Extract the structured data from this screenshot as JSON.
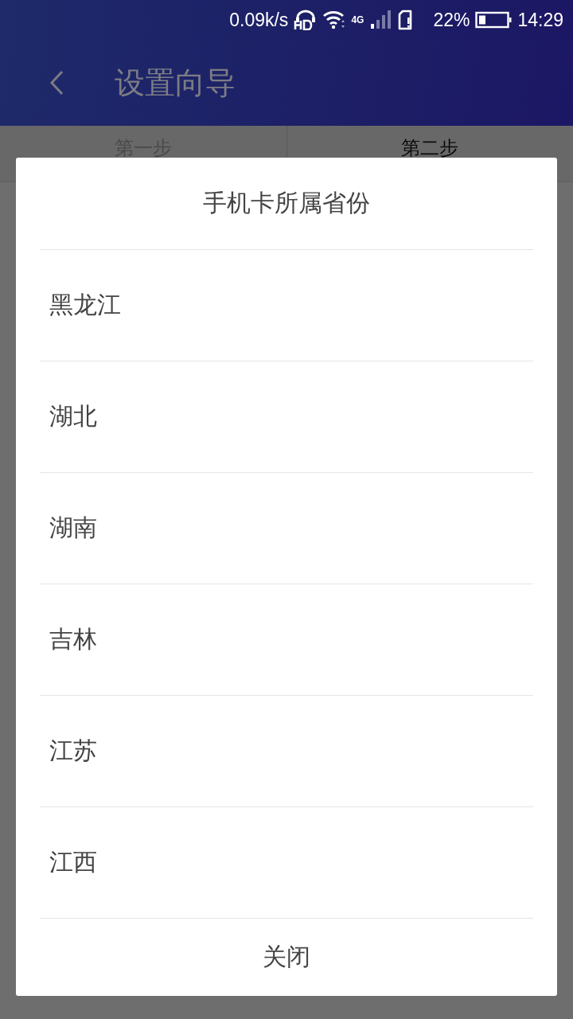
{
  "status_bar": {
    "speed": "0.09k/s",
    "network": "4G",
    "battery": "22%",
    "time": "14:29"
  },
  "header": {
    "title": "设置向导"
  },
  "steps": [
    {
      "label": "第一步",
      "selected": false
    },
    {
      "label": "第二步",
      "selected": true
    }
  ],
  "dialog": {
    "title": "手机卡所属省份",
    "options": [
      "黑龙江",
      "湖北",
      "湖南",
      "吉林",
      "江苏",
      "江西"
    ],
    "close": "关闭"
  }
}
